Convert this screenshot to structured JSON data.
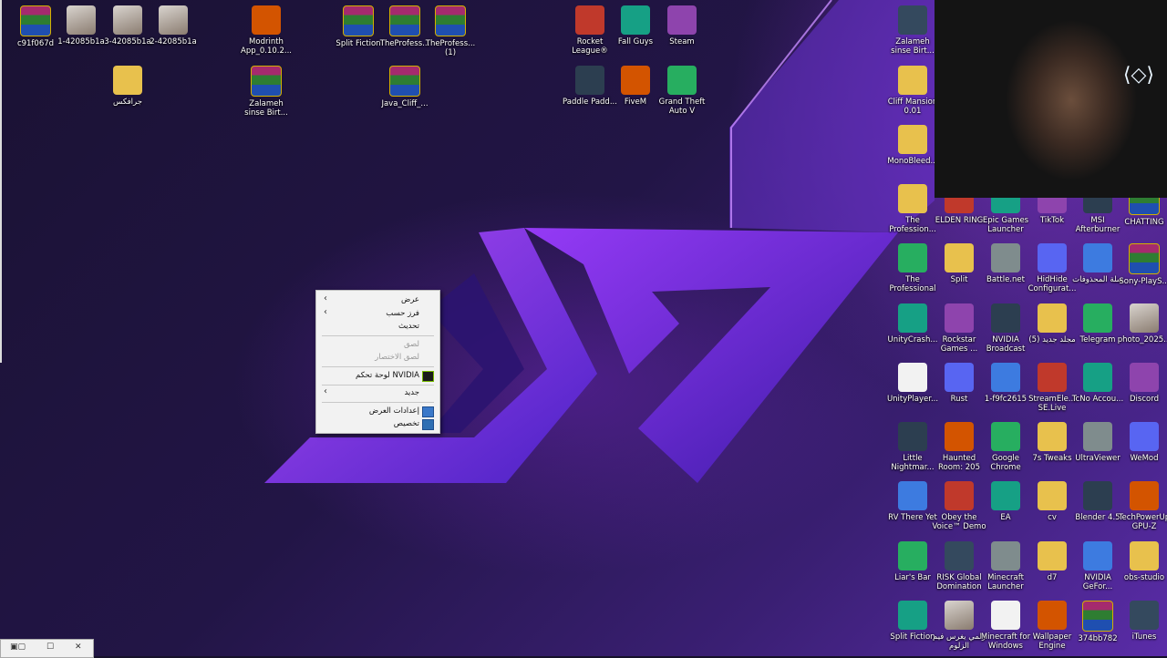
{
  "wallpaper": {
    "accent": "#8a3bff"
  },
  "desktop_icons": [
    {
      "label": "c91f067d",
      "icon": "winrar-archive-icon",
      "color": "rar"
    },
    {
      "label": "1-42085b1a",
      "icon": "photo-thumbnail-icon",
      "color": "photo"
    },
    {
      "label": "3-42085b1a",
      "icon": "photo-thumbnail-icon",
      "color": "photo"
    },
    {
      "label": "2-42085b1a",
      "icon": "photo-thumbnail-icon",
      "color": "photo"
    },
    {
      "label": "جرافكس",
      "icon": "folder-icon",
      "color": "folder"
    },
    {
      "label": "Modrinth App_0.10.2...",
      "icon": "modrinth-icon",
      "color": "app"
    },
    {
      "label": "Zalameh sinse Birt...",
      "icon": "winrar-archive-icon",
      "color": "rar"
    },
    {
      "label": "Split Fiction",
      "icon": "winrar-archive-icon",
      "color": "rar"
    },
    {
      "label": "TheProfess...",
      "icon": "winrar-archive-icon",
      "color": "rar"
    },
    {
      "label": "TheProfess... (1)",
      "icon": "winrar-archive-icon",
      "color": "rar"
    },
    {
      "label": "Java_Cliff_...",
      "icon": "winrar-archive-icon",
      "color": "rar"
    },
    {
      "label": "Rocket League®",
      "icon": "rocket-league-icon",
      "color": "app"
    },
    {
      "label": "Fall Guys",
      "icon": "fall-guys-icon",
      "color": "app"
    },
    {
      "label": "Steam",
      "icon": "steam-icon",
      "color": "app"
    },
    {
      "label": "Paddle Padd...",
      "icon": "paddle-icon",
      "color": "app"
    },
    {
      "label": "FiveM",
      "icon": "fivem-icon",
      "color": "app"
    },
    {
      "label": "Grand Theft Auto V",
      "icon": "gta-v-icon",
      "color": "app"
    },
    {
      "label": "Zalameh sinse Birt...",
      "icon": "zalameh-app-icon",
      "color": "app"
    },
    {
      "label": "Cliff Mansion 0.01",
      "icon": "folder-icon",
      "color": "folder"
    },
    {
      "label": "MonoBleed...",
      "icon": "folder-icon",
      "color": "folder"
    },
    {
      "label": "The Profession...",
      "icon": "folder-icon",
      "color": "folder"
    },
    {
      "label": "ELDEN RING",
      "icon": "elden-ring-icon",
      "color": "app"
    },
    {
      "label": "Epic Games Launcher",
      "icon": "epic-games-icon",
      "color": "app"
    },
    {
      "label": "TikTok",
      "icon": "tiktok-icon",
      "color": "app"
    },
    {
      "label": "MSI Afterburner",
      "icon": "msi-afterburner-icon",
      "color": "app"
    },
    {
      "label": "CHATTING",
      "icon": "winrar-archive-icon",
      "color": "rar"
    },
    {
      "label": "The Professional",
      "icon": "the-professional-icon",
      "color": "app"
    },
    {
      "label": "Split",
      "icon": "folder-icon",
      "color": "folder"
    },
    {
      "label": "Battle.net",
      "icon": "battlenet-icon",
      "color": "app"
    },
    {
      "label": "HidHide Configurat...",
      "icon": "hidhide-icon",
      "color": "app"
    },
    {
      "label": "سلة المحذوفات",
      "icon": "recycle-bin-icon",
      "color": "app"
    },
    {
      "label": "Sony-PlayS...",
      "icon": "winrar-archive-icon",
      "color": "rar"
    },
    {
      "label": "UnityCrash...",
      "icon": "unity-icon",
      "color": "app"
    },
    {
      "label": "Rockstar Games ...",
      "icon": "rockstar-icon",
      "color": "app"
    },
    {
      "label": "NVIDIA Broadcast",
      "icon": "nvidia-broadcast-icon",
      "color": "app"
    },
    {
      "label": "مجلد جديد (5)",
      "icon": "folder-icon",
      "color": "folder"
    },
    {
      "label": "Telegram",
      "icon": "telegram-icon",
      "color": "app"
    },
    {
      "label": "photo_2025...",
      "icon": "photo-thumbnail-icon",
      "color": "photo"
    },
    {
      "label": "UnityPlayer...",
      "icon": "settings-file-icon",
      "color": "doc"
    },
    {
      "label": "Rust",
      "icon": "rust-icon",
      "color": "app"
    },
    {
      "label": "1-f9fc2615",
      "icon": "emoji-photo-icon",
      "color": "app"
    },
    {
      "label": "StreamEle... SE.Live",
      "icon": "streamelements-icon",
      "color": "app"
    },
    {
      "label": "TcNo Accou...",
      "icon": "tcno-icon",
      "color": "app"
    },
    {
      "label": "Discord",
      "icon": "discord-icon",
      "color": "app"
    },
    {
      "label": "Little Nightmar...",
      "icon": "little-nightmares-icon",
      "color": "app"
    },
    {
      "label": "Haunted Room: 205",
      "icon": "haunted-room-icon",
      "color": "app"
    },
    {
      "label": "Google Chrome",
      "icon": "chrome-icon",
      "color": "app"
    },
    {
      "label": "7s Tweaks",
      "icon": "folder-icon",
      "color": "folder"
    },
    {
      "label": "UltraViewer",
      "icon": "ultraviewer-icon",
      "color": "app"
    },
    {
      "label": "WeMod",
      "icon": "wemod-icon",
      "color": "app"
    },
    {
      "label": "RV There Yet",
      "icon": "rv-there-yet-icon",
      "color": "app"
    },
    {
      "label": "Obey the Voice™ Demo",
      "icon": "obey-the-voice-icon",
      "color": "app"
    },
    {
      "label": "EA",
      "icon": "ea-icon",
      "color": "app"
    },
    {
      "label": "cv",
      "icon": "folder-icon",
      "color": "folder"
    },
    {
      "label": "Blender 4.5",
      "icon": "blender-icon",
      "color": "app"
    },
    {
      "label": "TechPowerUp GPU-Z",
      "icon": "gpu-z-icon",
      "color": "app"
    },
    {
      "label": "Liar's Bar",
      "icon": "liars-bar-icon",
      "color": "app"
    },
    {
      "label": "RISK Global Domination",
      "icon": "risk-icon",
      "color": "app"
    },
    {
      "label": "Minecraft Launcher",
      "icon": "minecraft-icon",
      "color": "app"
    },
    {
      "label": "d7",
      "icon": "folder-icon",
      "color": "folder"
    },
    {
      "label": "NVIDIA GeFor...",
      "icon": "nvidia-icon",
      "color": "app"
    },
    {
      "label": "obs-studio",
      "icon": "folder-icon",
      "color": "folder"
    },
    {
      "label": "Split Fiction",
      "icon": "split-fiction-icon",
      "color": "app"
    },
    {
      "label": "زلمي يغرس فيم الزلوم",
      "icon": "photo-thumbnail-icon",
      "color": "photo"
    },
    {
      "label": "Minecraft for Windows",
      "icon": "document-icon",
      "color": "doc"
    },
    {
      "label": "Wallpaper Engine",
      "icon": "wallpaper-engine-icon",
      "color": "app"
    },
    {
      "label": "374bb782",
      "icon": "winrar-archive-icon",
      "color": "rar"
    },
    {
      "label": "iTunes",
      "icon": "itunes-icon",
      "color": "app"
    }
  ],
  "context_menu": {
    "view": "عرض",
    "sort_by": "فرز حسب",
    "refresh": "تحديث",
    "paste": "لصق",
    "paste_shortcut": "لصق الاختصار",
    "nvidia": "لوحة تحكم NVIDIA",
    "new": "جديد",
    "display_settings": "إعدادات العرض",
    "personalize": "تخصيص"
  },
  "colors": {
    "menu_bg": "#f2f2f2",
    "disabled": "#9a9a9a"
  }
}
